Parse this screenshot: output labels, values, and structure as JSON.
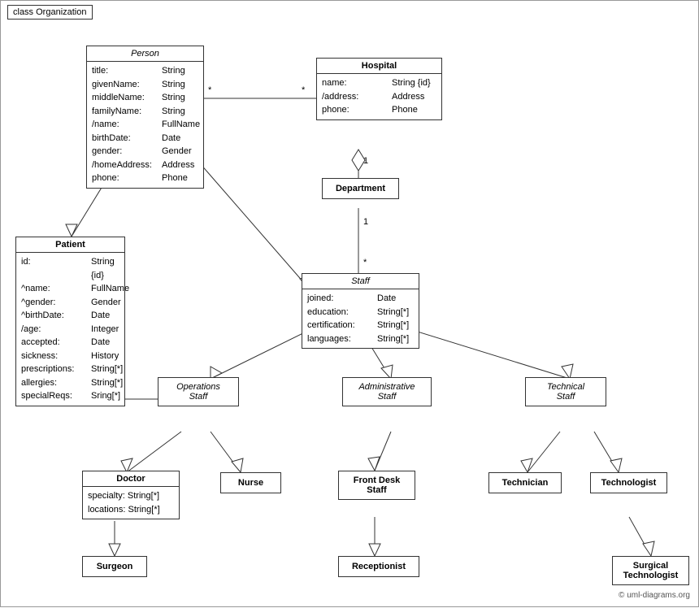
{
  "diagram": {
    "label": "class Organization",
    "classes": {
      "person": {
        "title": "Person",
        "italic": true,
        "attrs": [
          {
            "name": "title:",
            "type": "String"
          },
          {
            "name": "givenName:",
            "type": "String"
          },
          {
            "name": "middleName:",
            "type": "String"
          },
          {
            "name": "familyName:",
            "type": "String"
          },
          {
            "name": "/name:",
            "type": "FullName"
          },
          {
            "name": "birthDate:",
            "type": "Date"
          },
          {
            "name": "gender:",
            "type": "Gender"
          },
          {
            "name": "/homeAddress:",
            "type": "Address"
          },
          {
            "name": "phone:",
            "type": "Phone"
          }
        ]
      },
      "hospital": {
        "title": "Hospital",
        "italic": false,
        "attrs": [
          {
            "name": "name:",
            "type": "String {id}"
          },
          {
            "name": "/address:",
            "type": "Address"
          },
          {
            "name": "phone:",
            "type": "Phone"
          }
        ]
      },
      "department": {
        "title": "Department",
        "italic": false,
        "attrs": []
      },
      "staff": {
        "title": "Staff",
        "italic": true,
        "attrs": [
          {
            "name": "joined:",
            "type": "Date"
          },
          {
            "name": "education:",
            "type": "String[*]"
          },
          {
            "name": "certification:",
            "type": "String[*]"
          },
          {
            "name": "languages:",
            "type": "String[*]"
          }
        ]
      },
      "patient": {
        "title": "Patient",
        "italic": false,
        "attrs": [
          {
            "name": "id:",
            "type": "String {id}"
          },
          {
            "name": "^name:",
            "type": "FullName"
          },
          {
            "name": "^gender:",
            "type": "Gender"
          },
          {
            "name": "^birthDate:",
            "type": "Date"
          },
          {
            "name": "/age:",
            "type": "Integer"
          },
          {
            "name": "accepted:",
            "type": "Date"
          },
          {
            "name": "sickness:",
            "type": "History"
          },
          {
            "name": "prescriptions:",
            "type": "String[*]"
          },
          {
            "name": "allergies:",
            "type": "String[*]"
          },
          {
            "name": "specialReqs:",
            "type": "Sring[*]"
          }
        ]
      },
      "operationsStaff": {
        "title1": "Operations",
        "title2": "Staff",
        "italic": true
      },
      "administrativeStaff": {
        "title1": "Administrative",
        "title2": "Staff",
        "italic": true
      },
      "technicalStaff": {
        "title1": "Technical",
        "title2": "Staff",
        "italic": true
      },
      "doctor": {
        "title": "Doctor",
        "attrs": [
          {
            "name": "specialty:",
            "type": "String[*]"
          },
          {
            "name": "locations:",
            "type": "String[*]"
          }
        ]
      },
      "nurse": {
        "title": "Nurse"
      },
      "frontDeskStaff": {
        "title1": "Front Desk",
        "title2": "Staff"
      },
      "technician": {
        "title": "Technician"
      },
      "technologist": {
        "title": "Technologist"
      },
      "surgeon": {
        "title": "Surgeon"
      },
      "receptionist": {
        "title": "Receptionist"
      },
      "surgicalTechnologist": {
        "title1": "Surgical",
        "title2": "Technologist"
      }
    },
    "multiplicity": {
      "star": "*",
      "one": "1"
    },
    "copyright": "© uml-diagrams.org"
  }
}
